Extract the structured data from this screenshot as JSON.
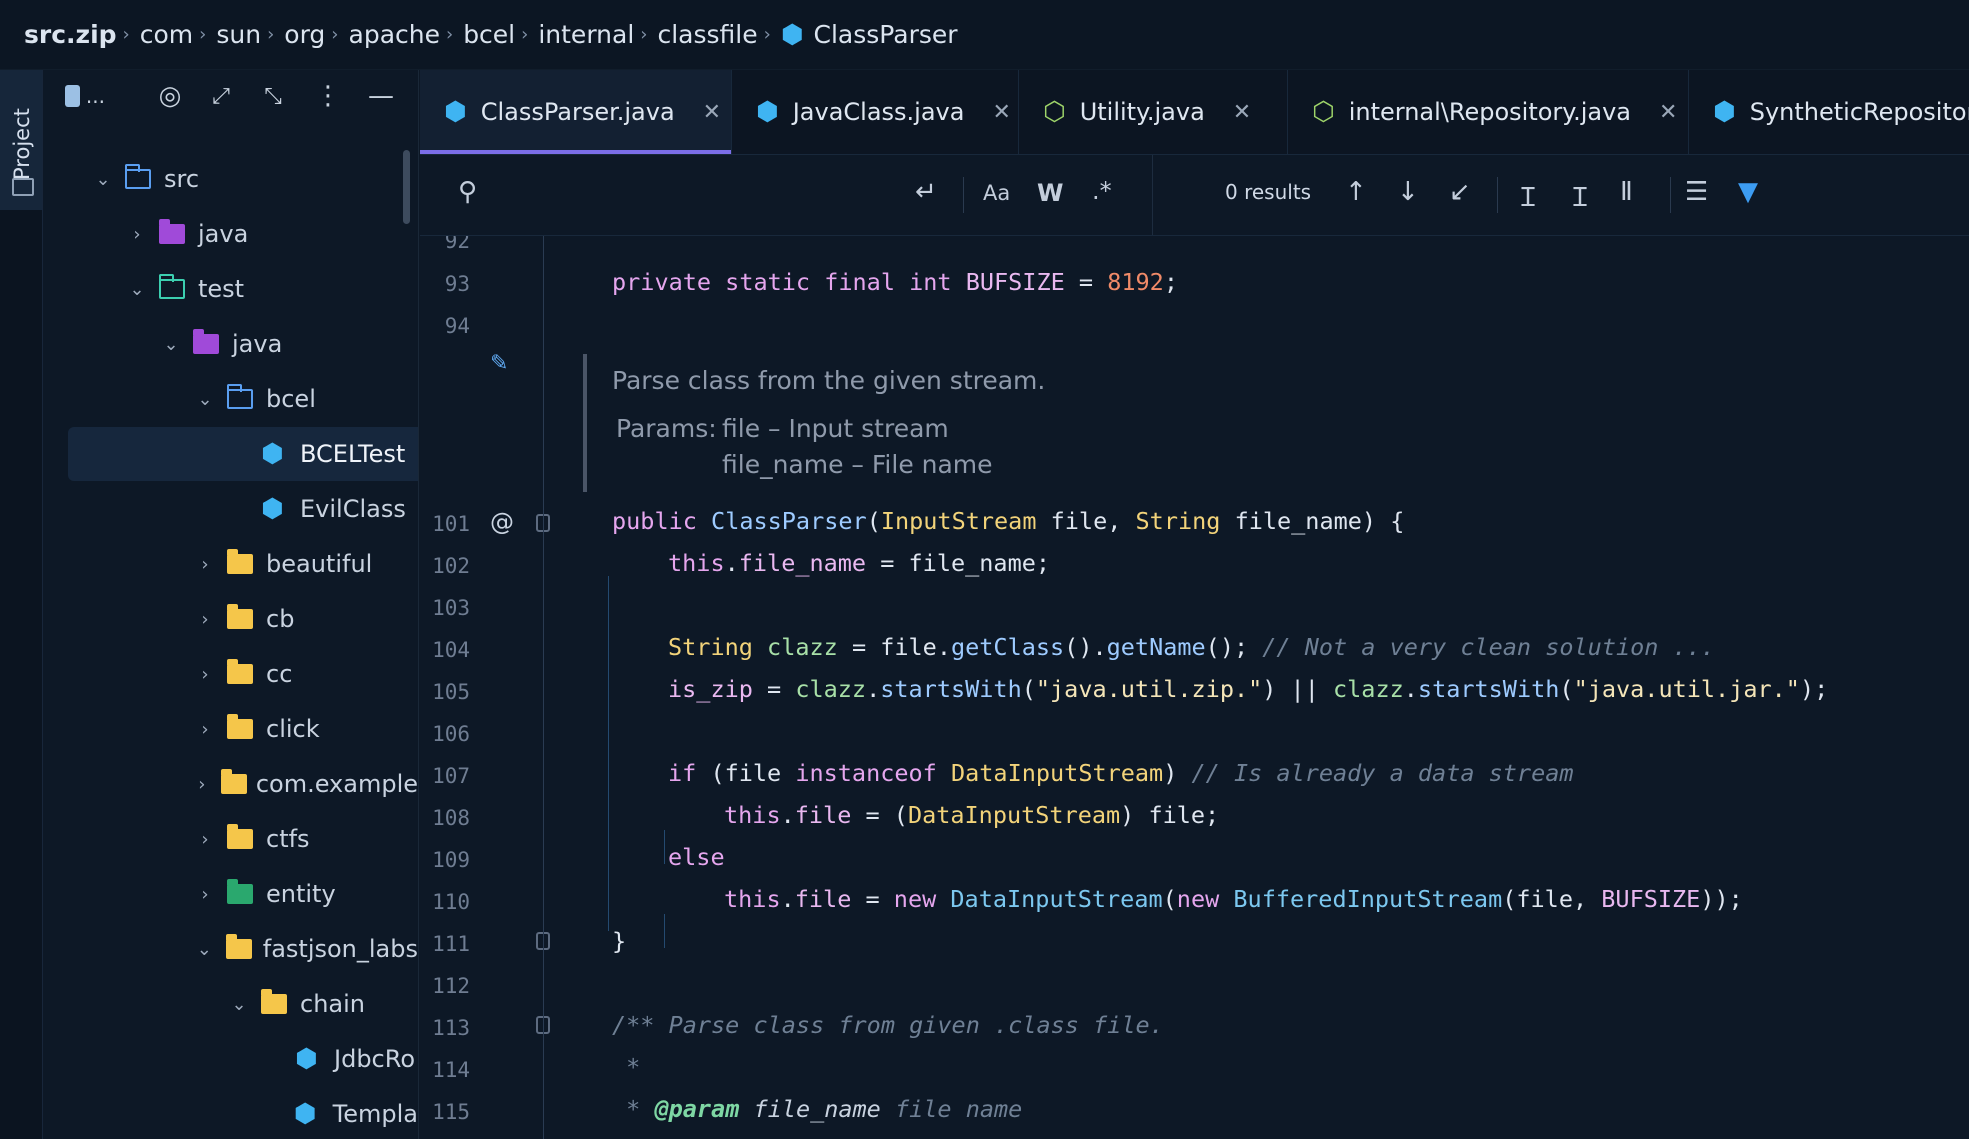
{
  "breadcrumb": {
    "items": [
      "src.zip",
      "com",
      "sun",
      "org",
      "apache",
      "bcel",
      "internal",
      "classfile",
      "ClassParser"
    ]
  },
  "sidebar": {
    "tool_window_label": "Project",
    "toolbar_ellipsis": "...",
    "tree": [
      {
        "label": "src",
        "depth": 0,
        "expanded": true,
        "icon": "source-folder-icon"
      },
      {
        "label": "java",
        "depth": 1,
        "expanded": false,
        "icon": "java-source-folder-icon"
      },
      {
        "label": "test",
        "depth": 1,
        "expanded": true,
        "icon": "test-folder-icon"
      },
      {
        "label": "java",
        "depth": 2,
        "expanded": true,
        "icon": "java-source-folder-icon"
      },
      {
        "label": "bcel",
        "depth": 3,
        "expanded": true,
        "icon": "package-folder-icon"
      },
      {
        "label": "BCELTest",
        "depth": 4,
        "selected": true,
        "icon": "java-class-icon"
      },
      {
        "label": "EvilClass",
        "depth": 4,
        "icon": "java-class-icon"
      },
      {
        "label": "beautiful",
        "depth": 3,
        "expanded": false,
        "icon": "folder-icon"
      },
      {
        "label": "cb",
        "depth": 3,
        "expanded": false,
        "icon": "folder-icon"
      },
      {
        "label": "cc",
        "depth": 3,
        "expanded": false,
        "icon": "folder-icon"
      },
      {
        "label": "click",
        "depth": 3,
        "expanded": false,
        "icon": "folder-icon"
      },
      {
        "label": "com.example",
        "depth": 3,
        "expanded": false,
        "icon": "folder-icon"
      },
      {
        "label": "ctfs",
        "depth": 3,
        "expanded": false,
        "icon": "folder-icon"
      },
      {
        "label": "entity",
        "depth": 3,
        "expanded": false,
        "icon": "entity-folder-icon"
      },
      {
        "label": "fastjson_labs",
        "depth": 3,
        "expanded": true,
        "icon": "folder-icon"
      },
      {
        "label": "chain",
        "depth": 4,
        "expanded": true,
        "icon": "folder-icon"
      },
      {
        "label": "JdbcRo",
        "depth": 5,
        "icon": "java-class-icon"
      },
      {
        "label": "Templa",
        "depth": 5,
        "icon": "java-class-icon"
      }
    ]
  },
  "tabs": [
    {
      "label": "ClassParser.java",
      "active": true,
      "icon": "class-file-icon"
    },
    {
      "label": "JavaClass.java",
      "icon": "class-file-icon"
    },
    {
      "label": "Utility.java",
      "icon": "utility-file-icon"
    },
    {
      "label": "internal\\Repository.java",
      "icon": "interface-file-icon"
    },
    {
      "label": "SyntheticRepository",
      "icon": "class-file-icon"
    }
  ],
  "search": {
    "value": "",
    "results": "0 results",
    "match_case_label": "Aa",
    "words_label": "W",
    "regex_label": ".*"
  },
  "editor": {
    "line_numbers": [
      "92",
      "93",
      "94",
      "101",
      "102",
      "103",
      "104",
      "105",
      "106",
      "107",
      "108",
      "109",
      "110",
      "111",
      "112",
      "113",
      "114",
      "115"
    ],
    "doc_comment": {
      "summary": "Parse class from the given stream.",
      "params_label": "Params:",
      "param1": "file – Input stream",
      "param2": "file_name – File name"
    },
    "colors": {
      "keyword": "#e5a6ee",
      "type": "#7cc8f0",
      "string": "#f4e5b8",
      "number": "#f08a68",
      "comment": "#6f8095",
      "accent": "#7b6ee8"
    }
  }
}
